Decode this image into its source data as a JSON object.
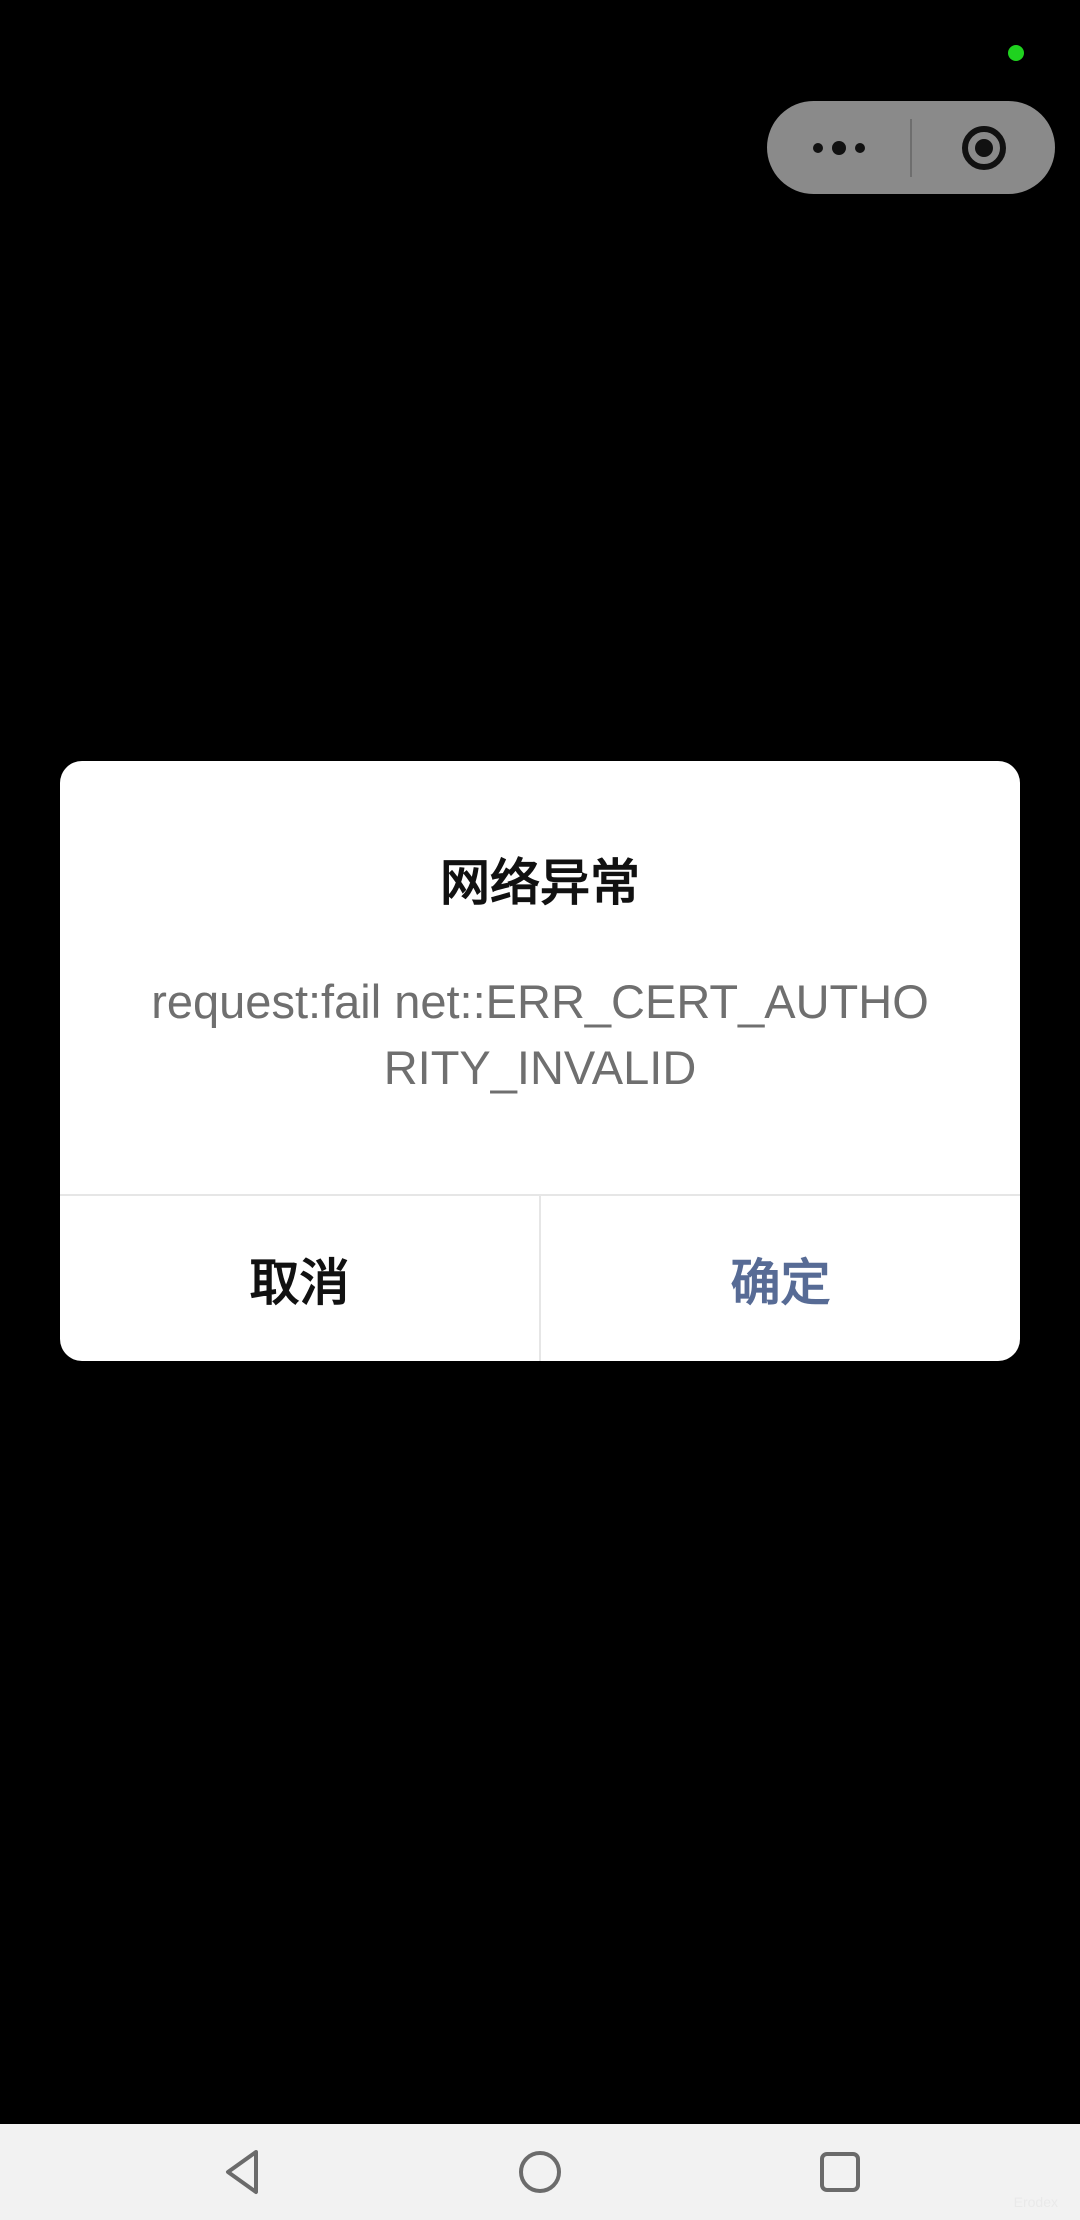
{
  "status_bar": {
    "indicator_color": "#1fd21f"
  },
  "capsule": {
    "more_icon": "more-dots-icon",
    "close_icon": "target-circle-icon"
  },
  "dialog": {
    "title": "网络异常",
    "message": "request:fail net::ERR_CERT_AUTHORITY_INVALID",
    "cancel_label": "取消",
    "confirm_label": "确定",
    "cancel_color": "#111111",
    "confirm_color": "#576b95"
  },
  "nav_bar": {
    "back_icon": "triangle-back-icon",
    "home_icon": "circle-home-icon",
    "recents_icon": "square-recents-icon",
    "watermark": "Erodex"
  }
}
